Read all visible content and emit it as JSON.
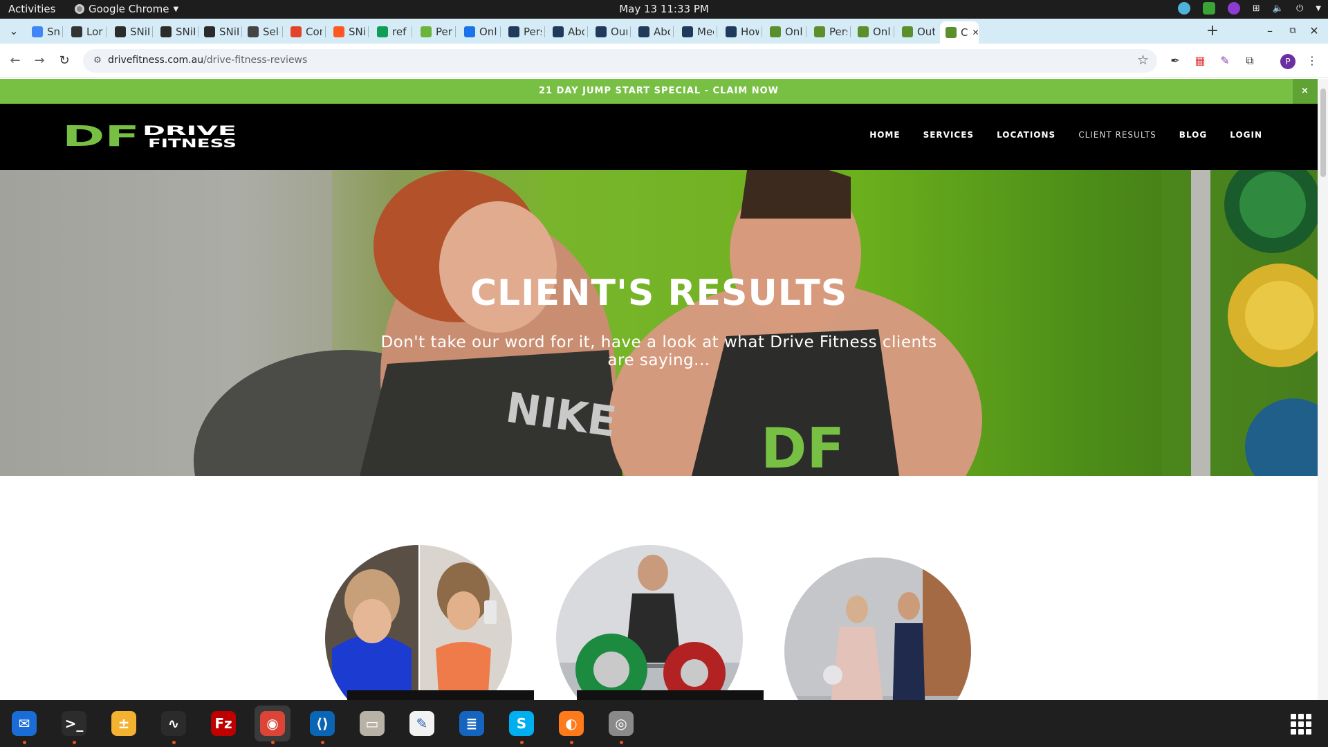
{
  "topbar": {
    "activities": "Activities",
    "app_name": "Google Chrome",
    "clock": "May 13  11:33 PM"
  },
  "tabs": [
    {
      "title": "Snip",
      "color": "#4285f4"
    },
    {
      "title": "Lore",
      "color": "#333333"
    },
    {
      "title": "SNiP",
      "color": "#2b2b2b"
    },
    {
      "title": "SNiP",
      "color": "#2b2b2b"
    },
    {
      "title": "SNiP",
      "color": "#2b2b2b"
    },
    {
      "title": "Sele",
      "color": "#444444"
    },
    {
      "title": "Com",
      "color": "#e24329"
    },
    {
      "title": "SNiP",
      "color": "#ff5722"
    },
    {
      "title": "ref -",
      "color": "#0f9d58"
    },
    {
      "title": "Pers",
      "color": "#6cb33e"
    },
    {
      "title": "Onli",
      "color": "#1a73e8"
    },
    {
      "title": "Pers",
      "color": "#1f3a5a"
    },
    {
      "title": "Abo",
      "color": "#1f3a5a"
    },
    {
      "title": "Our",
      "color": "#1f3a5a"
    },
    {
      "title": "Abo",
      "color": "#1f3a5a"
    },
    {
      "title": "Mee",
      "color": "#1f3a5a"
    },
    {
      "title": "How",
      "color": "#1f3a5a"
    },
    {
      "title": "Onli",
      "color": "#5a8f2c"
    },
    {
      "title": "Pers",
      "color": "#5a8f2c"
    },
    {
      "title": "Onli",
      "color": "#5a8f2c"
    },
    {
      "title": "Outc",
      "color": "#5a8f2c"
    },
    {
      "title": "C",
      "color": "#5a8f2c",
      "active": true
    }
  ],
  "toolbar": {
    "url_domain": "drivefitness.com.au",
    "url_path": "/drive-fitness-reviews",
    "avatar_letter": "P"
  },
  "promo": {
    "text": "21 DAY JUMP START SPECIAL - CLAIM NOW",
    "close": "×"
  },
  "site": {
    "logo_df": "DF",
    "logo_line1": "DRIVE",
    "logo_line2": "FITNESS",
    "menu": [
      "HOME",
      "SERVICES",
      "LOCATIONS",
      "CLIENT RESULTS",
      "BLOG",
      "LOGIN"
    ],
    "menu_current": 3,
    "accent": "#77c043"
  },
  "hero": {
    "title": "CLIENT'S RESULTS",
    "subtitle": "Don't take our word for it, have a look at what Drive Fitness clients are saying...",
    "shirt_text_left": "NIKE",
    "shirt_text_right": "DF"
  },
  "results": [
    {
      "image": "before-after-photo"
    },
    {
      "image": "deadlift-photo"
    },
    {
      "image": "wedding-photo"
    }
  ],
  "dock": [
    {
      "name": "thunderbird-icon",
      "running": true,
      "color": "#1a6dd6",
      "glyph": "✉"
    },
    {
      "name": "terminal-icon",
      "running": true,
      "color": "#2c2c2c",
      "glyph": ">_"
    },
    {
      "name": "calculator-icon",
      "running": false,
      "color": "#f3b22f",
      "glyph": "±"
    },
    {
      "name": "system-monitor-icon",
      "running": true,
      "color": "#2b2b2b",
      "glyph": "∿"
    },
    {
      "name": "filezilla-icon",
      "running": false,
      "color": "#bf0000",
      "glyph": "Fz"
    },
    {
      "name": "chrome-icon",
      "running": true,
      "color": "#db4437",
      "glyph": "◉",
      "focused": true
    },
    {
      "name": "vscode-icon",
      "running": true,
      "color": "#0a66b5",
      "glyph": "⟨⟩"
    },
    {
      "name": "files-icon",
      "running": false,
      "color": "#b8b2a6",
      "glyph": "▭"
    },
    {
      "name": "text-editor-icon",
      "running": false,
      "color": "#f2f2f2",
      "glyph": "✎"
    },
    {
      "name": "libreoffice-writer-icon",
      "running": false,
      "color": "#1565c0",
      "glyph": "≣"
    },
    {
      "name": "skype-icon",
      "running": true,
      "color": "#00aff0",
      "glyph": "S"
    },
    {
      "name": "firefox-dev-icon",
      "running": true,
      "color": "#ff7a1a",
      "glyph": "◐"
    },
    {
      "name": "disk-utility-icon",
      "running": true,
      "color": "#8a8a8a",
      "glyph": "◎"
    }
  ]
}
